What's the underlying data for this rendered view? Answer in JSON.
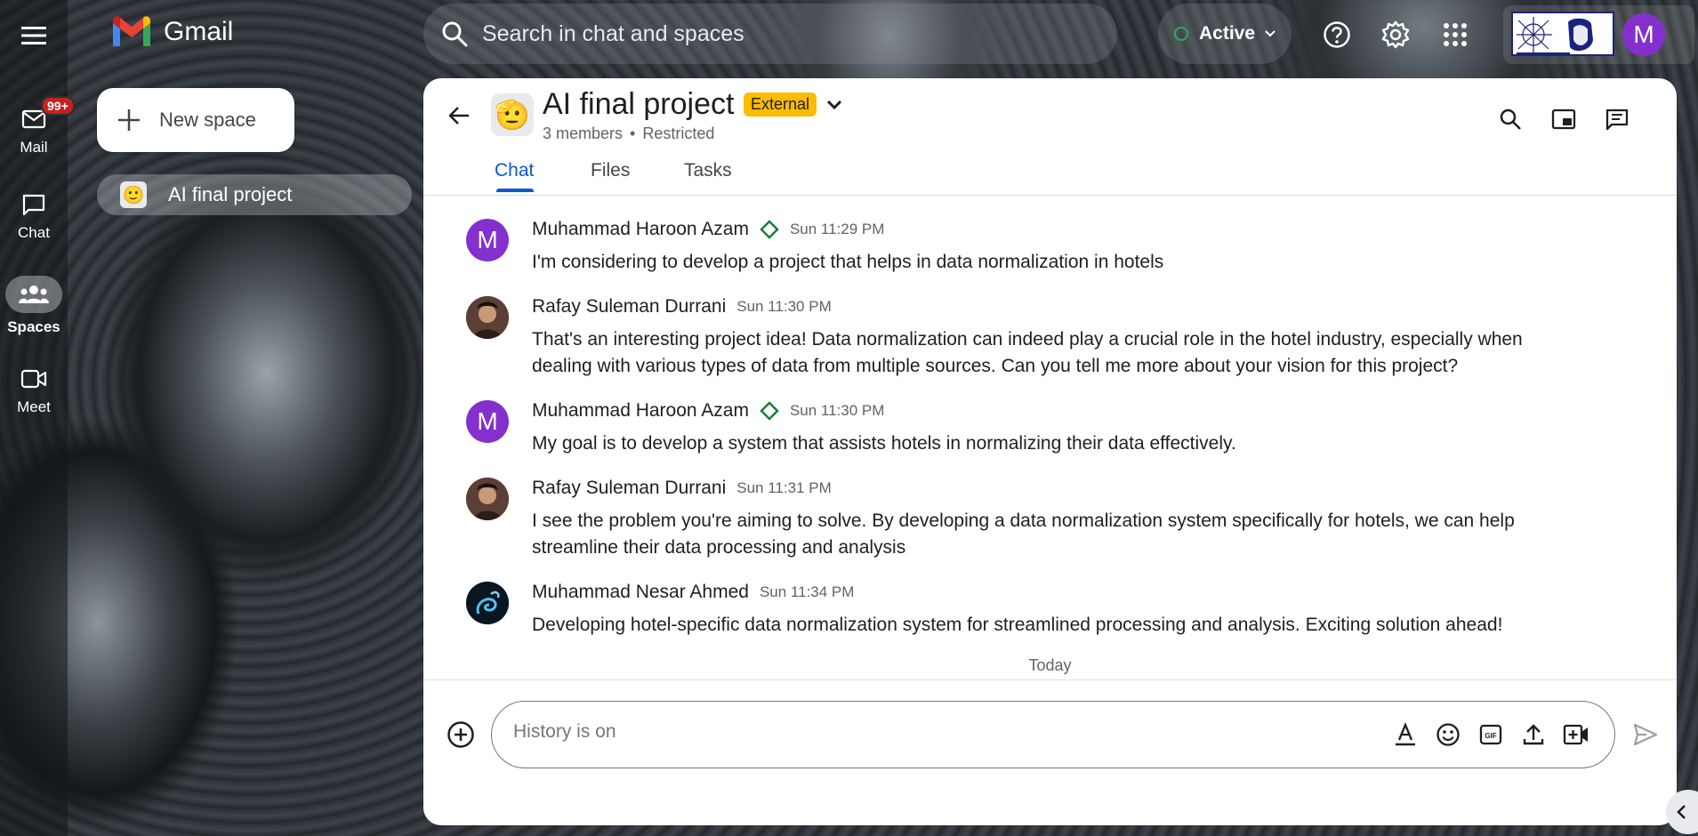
{
  "app": {
    "name": "Gmail"
  },
  "search": {
    "placeholder": "Search in chat and spaces"
  },
  "status": {
    "label": "Active",
    "color": "#34a853"
  },
  "account": {
    "initial": "M",
    "avatar_color": "#8430ce"
  },
  "rail": {
    "mail": {
      "label": "Mail",
      "badge": "99+"
    },
    "chat": {
      "label": "Chat"
    },
    "spaces": {
      "label": "Spaces"
    },
    "meet": {
      "label": "Meet"
    }
  },
  "sidebar": {
    "new_space_label": "New space",
    "spaces": [
      {
        "label": "AI final project",
        "emoji": "🙂"
      }
    ]
  },
  "space": {
    "emoji": "🫡",
    "title": "AI final project",
    "badge": "External",
    "members": "3 members",
    "separator": "•",
    "access": "Restricted"
  },
  "tabs": [
    {
      "label": "Chat",
      "active": true
    },
    {
      "label": "Files",
      "active": false
    },
    {
      "label": "Tasks",
      "active": false
    }
  ],
  "messages": [
    {
      "sender": "Muhammad Haroon Azam",
      "initial": "M",
      "time": "Sun 11:29 PM",
      "verified": true,
      "text": "I'm considering to develop a project that helps in data normalization in hotels"
    },
    {
      "sender": "Rafay Suleman Durrani",
      "initial": "",
      "time": "Sun 11:30 PM",
      "verified": false,
      "text": "That's an interesting project idea! Data normalization can indeed play a crucial role in the hotel industry, especially when dealing with various types of data from multiple sources. Can you tell me more about your vision for this project?"
    },
    {
      "sender": "Muhammad Haroon Azam",
      "initial": "M",
      "time": "Sun 11:30 PM",
      "verified": true,
      "text": "My goal is to develop a system that assists hotels in normalizing their data effectively."
    },
    {
      "sender": "Rafay Suleman Durrani",
      "initial": "",
      "time": "Sun 11:31 PM",
      "verified": false,
      "text": "I see the problem you're aiming to solve. By developing a data normalization system specifically for hotels, we can help streamline their data processing and analysis"
    },
    {
      "sender": "Muhammad Nesar Ahmed",
      "initial": "",
      "time": "Sun 11:34 PM",
      "verified": false,
      "text": "Developing hotel-specific data normalization system for streamlined processing and analysis. Exciting solution ahead!"
    }
  ],
  "divider": {
    "label": "Today"
  },
  "compose": {
    "placeholder": "History is on"
  },
  "colors": {
    "accent": "#0b57d0",
    "external_badge": "#fbbc04",
    "purple_avatar": "#8430ce"
  }
}
